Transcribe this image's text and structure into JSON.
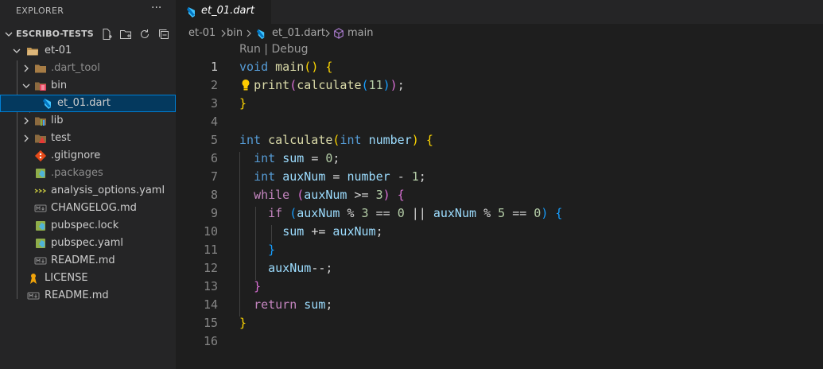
{
  "sidebar": {
    "title": "EXPLORER",
    "more_label": "···",
    "section_title": "ESCRIBO-TESTS",
    "actions": [
      "new-file-icon",
      "new-folder-icon",
      "refresh-icon",
      "collapse-all-icon"
    ],
    "tree": [
      {
        "label": "et-01",
        "type": "folder",
        "expanded": true
      },
      {
        "label": ".dart_tool",
        "type": "folder",
        "expanded": false
      },
      {
        "label": "bin",
        "type": "folder",
        "expanded": true
      },
      {
        "label": "et_01.dart",
        "type": "file",
        "selected": true
      },
      {
        "label": "lib",
        "type": "folder",
        "expanded": false
      },
      {
        "label": "test",
        "type": "folder",
        "expanded": false
      },
      {
        "label": ".gitignore",
        "type": "file"
      },
      {
        "label": ".packages",
        "type": "file"
      },
      {
        "label": "analysis_options.yaml",
        "type": "file"
      },
      {
        "label": "CHANGELOG.md",
        "type": "file"
      },
      {
        "label": "pubspec.lock",
        "type": "file"
      },
      {
        "label": "pubspec.yaml",
        "type": "file"
      },
      {
        "label": "README.md",
        "type": "file"
      },
      {
        "label": "LICENSE",
        "type": "file"
      },
      {
        "label": "README.md",
        "type": "file"
      }
    ]
  },
  "tab": {
    "label": "et_01.dart"
  },
  "breadcrumb": {
    "items": [
      "et-01",
      "bin",
      "et_01.dart",
      "main"
    ]
  },
  "editor": {
    "codelens": "Run | Debug",
    "line_numbers": [
      "1",
      "2",
      "3",
      "4",
      "5",
      "6",
      "7",
      "8",
      "9",
      "10",
      "11",
      "12",
      "13",
      "14",
      "15",
      "16"
    ],
    "code": [
      "void main() {",
      "  print(calculate(11));",
      "}",
      "",
      "int calculate(int number) {",
      "  int sum = 0;",
      "  int auxNum = number - 1;",
      "  while (auxNum >= 3) {",
      "    if (auxNum % 3 == 0 || auxNum % 5 == 0) {",
      "      sum += auxNum;",
      "    }",
      "    auxNum--;",
      "  }",
      "  return sum;",
      "}",
      ""
    ]
  },
  "colors": {
    "accent": "#007acc",
    "selection": "#04395e",
    "keyword": "#569cd6",
    "function": "#dcdcaa",
    "variable": "#9cdcfe",
    "number": "#b5cea8"
  }
}
